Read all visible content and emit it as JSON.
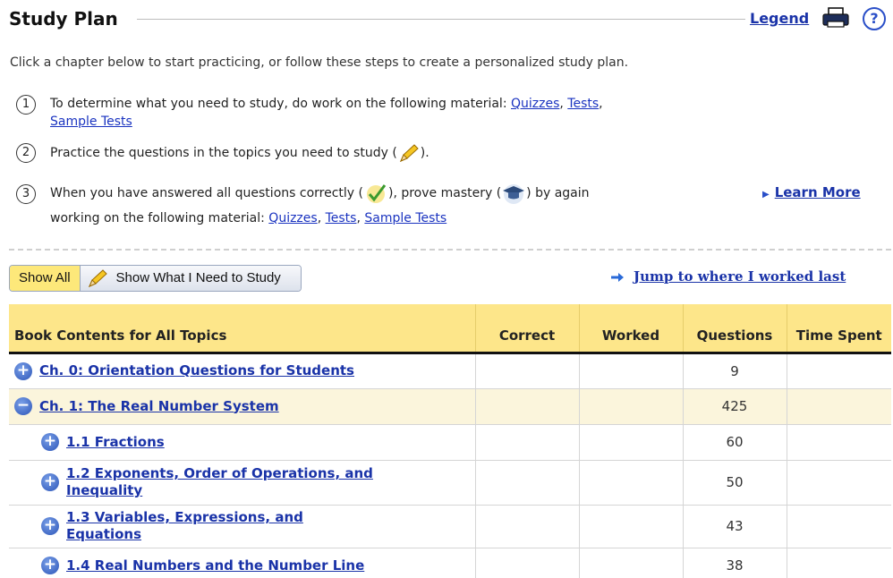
{
  "header": {
    "title": "Study Plan",
    "legend_label": "Legend",
    "help_label": "?"
  },
  "intro": "Click a chapter below to start practicing, or follow these steps to create a personalized study plan.",
  "steps": [
    {
      "num": "1",
      "text": "To determine what you need to study, do work on the following material:",
      "links": [
        "Quizzes",
        "Tests",
        "Sample Tests"
      ]
    },
    {
      "num": "2",
      "text_before": "Practice the questions in the topics you need to study (",
      "text_after": ")."
    },
    {
      "num": "3",
      "text_a": "When you have answered all questions correctly (",
      "text_b": "), prove mastery (",
      "text_c": ") by again",
      "text_d": "working on the following material:",
      "links": [
        "Quizzes",
        "Tests",
        "Sample Tests"
      ]
    }
  ],
  "learn_more": "Learn More",
  "buttons": {
    "show_all": "Show All",
    "show_need": "Show What I Need to Study"
  },
  "jump_label": "Jump to where I worked last",
  "table": {
    "headers": {
      "contents": "Book Contents for All Topics",
      "correct": "Correct",
      "worked": "Worked",
      "questions": "Questions",
      "time_spent": "Time Spent"
    },
    "rows": [
      {
        "title": "Ch. 0: Orientation Questions for Students",
        "toggle": "+",
        "questions": "9"
      },
      {
        "title": "Ch. 1: The Real Number System",
        "toggle": "−",
        "questions": "425"
      },
      {
        "title": "1.1 Fractions",
        "toggle": "+",
        "questions": "60"
      },
      {
        "title": "1.2 Exponents, Order of Operations, and Inequality",
        "toggle": "+",
        "questions": "50"
      },
      {
        "title": "1.3 Variables, Expressions, and Equations",
        "toggle": "+",
        "questions": "43"
      },
      {
        "title": "1.4 Real Numbers and the Number Line",
        "toggle": "+",
        "questions": "38"
      }
    ]
  }
}
